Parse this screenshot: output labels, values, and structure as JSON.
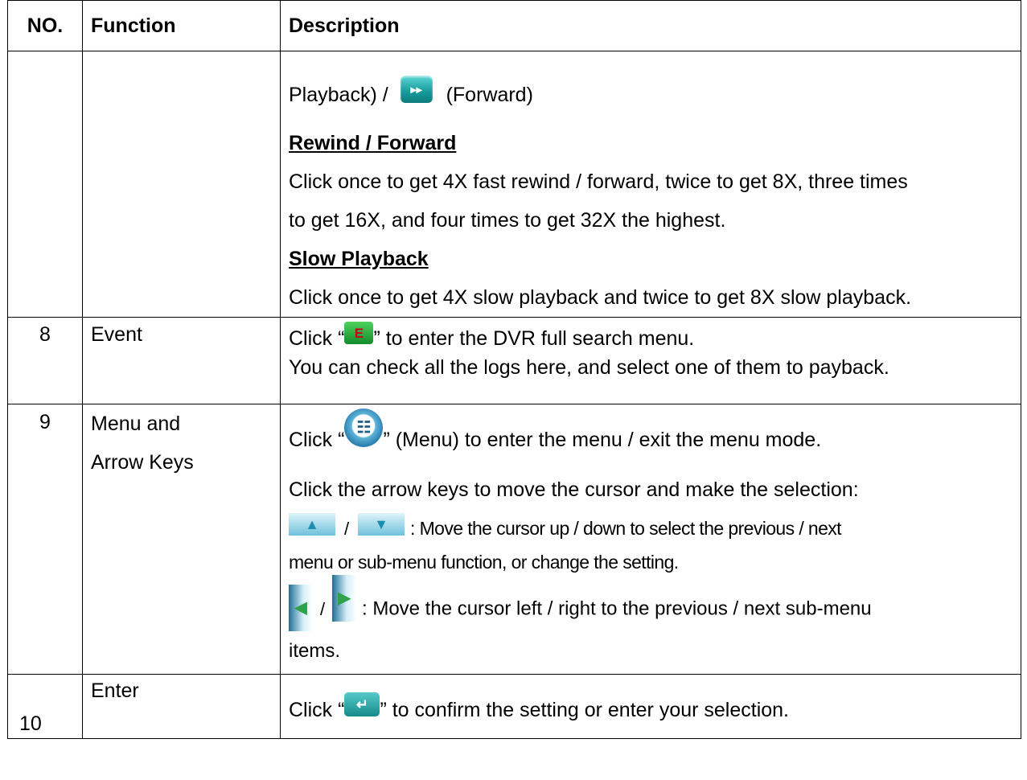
{
  "headers": {
    "no": "NO.",
    "function": "Function",
    "description": "Description"
  },
  "row_cont": {
    "line1_prefix": "Playback) /",
    "line1_suffix": "(Forward)",
    "rewind_heading": "Rewind / Forward",
    "rewind_text_1": "Click once to get 4X fast rewind / forward, twice to get 8X, three times",
    "rewind_text_2": "to get 16X, and four times to get 32X the highest.",
    "slow_heading": "Slow Playback",
    "slow_text": "Click once to get 4X slow playback and twice to get 8X slow playback."
  },
  "row8": {
    "no": "8",
    "function": "Event",
    "click": "Click “",
    "after_icon": "” to enter the DVR full search menu.",
    "line2": "You can check all the logs here, and select one of them to payback."
  },
  "row9": {
    "no": "9",
    "function_1": "Menu and",
    "function_2": "Arrow Keys",
    "click": "Click “",
    "after_icon": "” (Menu) to enter the menu / exit the menu mode.",
    "arrow_intro": "Click the arrow keys to move the cursor and make the selection:",
    "slash": "/",
    "updown_text": ": Move the cursor up / down to select the previous / next",
    "updown_text_2": "menu or sub-menu function, or change the setting.",
    "leftright_text": ": Move the cursor left / right to the previous / next sub-menu",
    "leftright_text_2": "items."
  },
  "row10": {
    "no": "10",
    "function": "Enter",
    "click": "Click “",
    "after_icon": "” to confirm the setting or enter your selection."
  },
  "icons": {
    "forward": "▸▸",
    "event": "E",
    "menu": "☷",
    "up": "▲",
    "down": "▼",
    "left": "◀",
    "right": "▶",
    "enter": "↵"
  }
}
